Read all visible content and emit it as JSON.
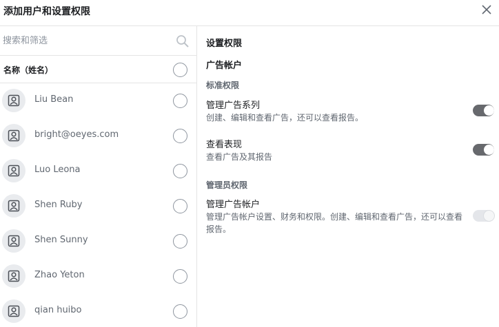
{
  "dialog": {
    "title": "添加用户和设置权限",
    "close_icon": "close-icon"
  },
  "left_panel": {
    "search": {
      "placeholder": "搜索和筛选",
      "value": "",
      "icon": "search-icon"
    },
    "column_header": "名称（姓名）",
    "users": [
      {
        "name": "Liu Bean"
      },
      {
        "name": "bright@oeyes.com"
      },
      {
        "name": "Luo Leona"
      },
      {
        "name": "Shen Ruby"
      },
      {
        "name": "Shen Sunny"
      },
      {
        "name": "Zhao Yeton"
      },
      {
        "name": "qian huibo"
      }
    ]
  },
  "right_panel": {
    "section_title": "设置权限",
    "account_title": "广告帐户",
    "standard_label": "标准权限",
    "admin_label": "管理员权限",
    "permissions": {
      "manage_campaigns": {
        "title": "管理广告系列",
        "desc": "创建、编辑和查看广告，还可以查看报告。",
        "enabled": false
      },
      "view_performance": {
        "title": "查看表现",
        "desc": "查看广告及其报告",
        "enabled": false
      },
      "manage_account": {
        "title": "管理广告帐户",
        "desc": "管理广告帐户设置、财务和权限。创建、编辑和查看广告，还可以查看报告。",
        "enabled": false,
        "disabled": true
      }
    }
  },
  "colors": {
    "toggle_off": "#67696d",
    "toggle_disabled": "#e4e6ea",
    "text_primary": "#1c1e21",
    "text_secondary": "#606770",
    "divider": "#e4e4e4"
  }
}
